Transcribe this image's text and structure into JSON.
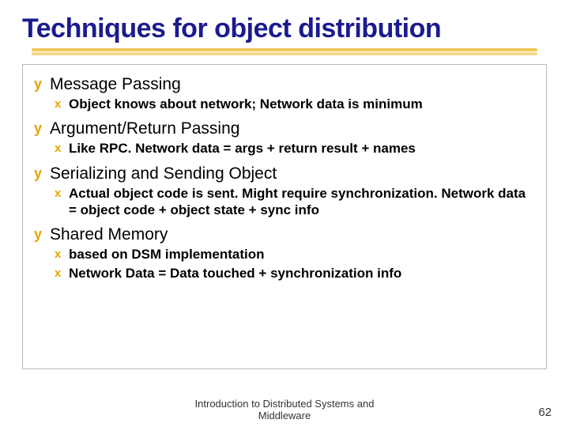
{
  "title": "Techniques for object distribution",
  "points": [
    {
      "label": "Message Passing",
      "subs": [
        "Object knows about network; Network data is minimum"
      ]
    },
    {
      "label": "Argument/Return Passing",
      "subs": [
        "Like RPC.  Network data = args + return result + names"
      ]
    },
    {
      "label": "Serializing and Sending Object",
      "subs": [
        "Actual object code is sent.  Might require synchronization. Network data = object code + object state + sync info"
      ]
    },
    {
      "label": "Shared Memory",
      "subs": [
        "based on DSM implementation",
        "Network Data = Data touched + synchronization info"
      ]
    }
  ],
  "footer_line1": "Introduction to Distributed Systems and",
  "footer_line2": "Middleware",
  "page_number": "62",
  "bullets": {
    "y": "y",
    "x": "x"
  }
}
